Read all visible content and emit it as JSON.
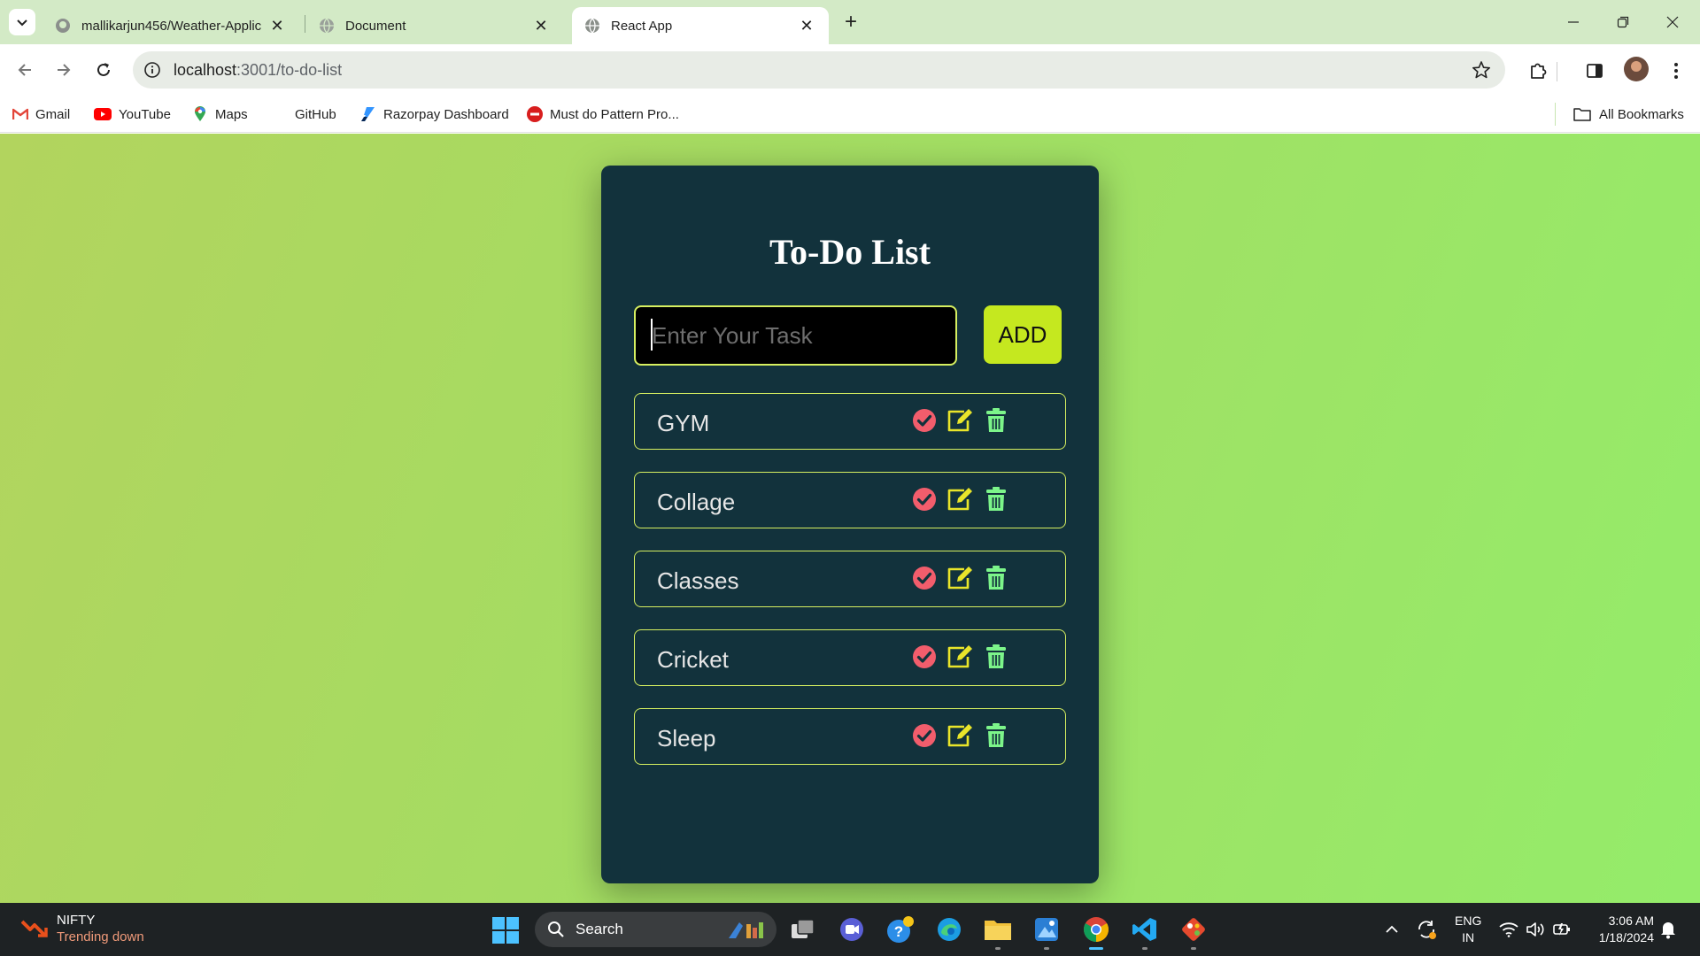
{
  "browser": {
    "tabs": [
      {
        "title": "mallikarjun456/Weather-Applic",
        "active": false,
        "favicon": "github-icon"
      },
      {
        "title": "Document",
        "active": false,
        "favicon": "globe-icon"
      },
      {
        "title": "React App",
        "active": true,
        "favicon": "globe-icon"
      }
    ],
    "url_host": "localhost",
    "url_path": ":3001/to-do-list",
    "bookmarks": [
      "Gmail",
      "YouTube",
      "Maps",
      "GitHub",
      "Razorpay Dashboard",
      "Must do Pattern Pro..."
    ],
    "all_bookmarks": "All Bookmarks",
    "tab_strip_color": "#d3eac6"
  },
  "app": {
    "title": "To-Do List",
    "input_placeholder": "Enter Your Task",
    "add_label": "ADD",
    "tasks": [
      "GYM",
      "Collage",
      "Classes",
      "Cricket",
      "Sleep"
    ],
    "colors": {
      "card": "#12323c",
      "accent": "#c5e81f",
      "complete_icon": "#f25d6c",
      "edit_icon": "#e9e52a",
      "delete_icon": "#7cf58a"
    }
  },
  "taskbar": {
    "news_title": "NIFTY",
    "news_subtitle": "Trending down",
    "search_label": "Search",
    "lang_line1": "ENG",
    "lang_line2": "IN",
    "time": "3:06 AM",
    "date": "1/18/2024"
  }
}
